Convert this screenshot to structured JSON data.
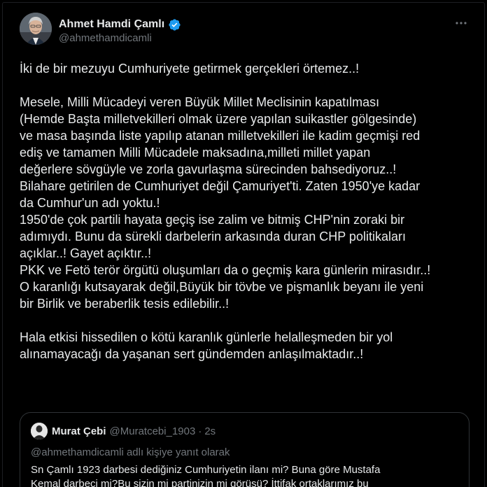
{
  "author": {
    "name": "Ahmet Hamdi Çamlı",
    "handle": "@ahmethamdicamli",
    "verified": true,
    "avatar_icon": "profile-photo",
    "verified_icon": "verified-badge-icon",
    "more_icon": "more-options-icon"
  },
  "tweet": {
    "lines": [
      "İki de bir mezuyu Cumhuriyete getirmek gerçekleri örtemez..!",
      "Mesele, Milli Mücadeyi veren Büyük Millet Meclisinin kapatılması",
      "(Hemde Başta milletvekilleri olmak üzere yapılan suikastler gölgesinde)",
      "ve masa başında liste yapılıp atanan milletvekilleri ile kadim geçmişi red",
      "ediş ve tamamen Milli Mücadele maksadına,milleti millet yapan",
      "değerlere sövgüyle ve zorla gavurlaşma sürecinden bahsediyoruz..!",
      "Bilahare getirilen de Cumhuriyet değil Çamuriyet'ti. Zaten 1950'ye kadar",
      "da Cumhur'un adı yoktu.!",
      "1950'de çok partili hayata geçiş ise zalim ve bitmiş CHP'nin zoraki bir",
      "adımıydı. Bunu da sürekli darbelerin arkasında duran CHP politikaları",
      "açıklar..! Gayet açıktır..!",
      "PKK ve Fetö terör örgütü oluşumları da o geçmiş kara günlerin mirasıdır..!",
      "O karanlığı kutsayarak değil,Büyük bir tövbe ve pişmanlık beyanı ile yeni",
      "bir Birlik ve beraberlik tesis edilebilir..!",
      "Hala etkisi hissedilen o kötü karanlık günlerle helalleşmeden bir yol",
      "alınamayacağı da yaşanan sert gündemden anlaşılmaktadır..!"
    ]
  },
  "quoted": {
    "name": "Murat Çebi",
    "handle": "@Muratcebi_1903",
    "separator": "·",
    "time": "2s",
    "reply_note": "@ahmethamdicamli adlı kişiye yanıt olarak",
    "lines": [
      "Sn Çamlı 1923 darbesi dediğiniz Cumhuriyetin ilanı mi? Buna göre Mustafa",
      "Kemal darbeci mi?Bu sizin mi partinizin mi görüşü? İttifak ortaklarımız bu"
    ]
  },
  "colors": {
    "background": "#000000",
    "text": "#e7e9ea",
    "secondary": "#71767b",
    "border": "#2f3336",
    "verified": "#1d9bf0"
  }
}
